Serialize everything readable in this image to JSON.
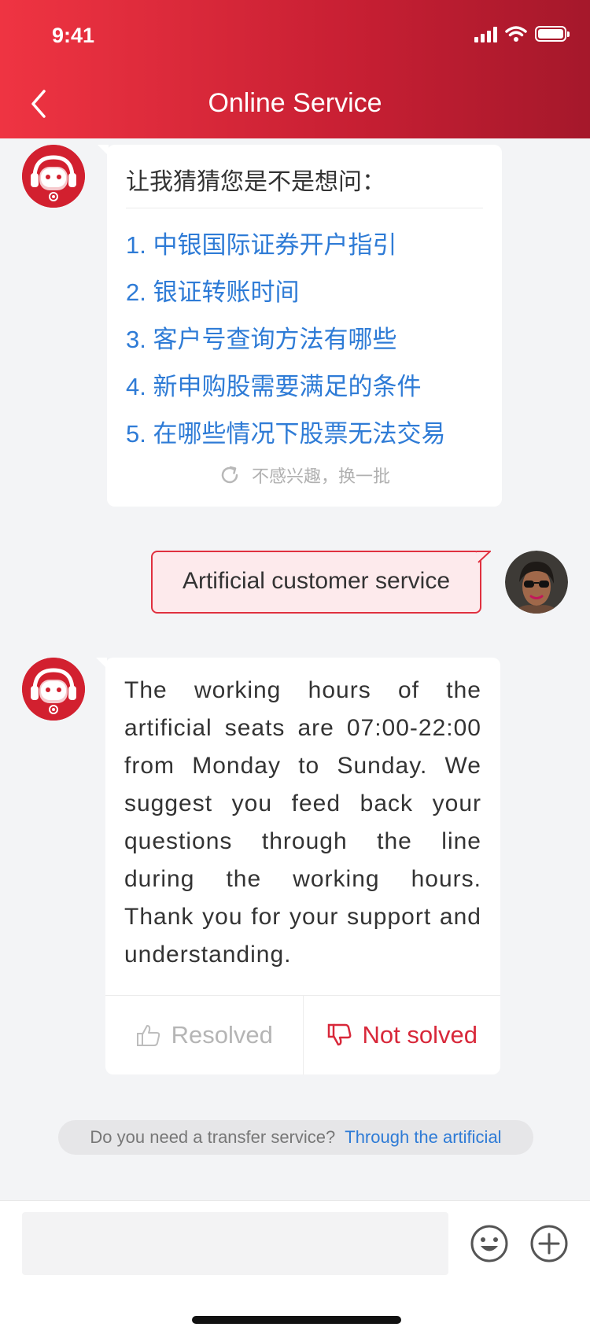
{
  "status_bar": {
    "time": "9:41"
  },
  "header": {
    "title": "Online Service"
  },
  "bot_suggestions": {
    "prompt": "让我猜猜您是不是想问：",
    "questions": [
      "1. 中银国际证券开户指引",
      "2. 银证转账时间",
      "3. 客户号查询方法有哪些",
      "4. 新申购股需要满足的条件",
      "5. 在哪些情况下股票无法交易"
    ],
    "refresh_label": "不感兴趣，换一批"
  },
  "user_message": {
    "text": "Artificial customer service"
  },
  "bot_reply": {
    "text": "The working hours of the artificial seats are 07:00-22:00 from Monday to Sunday. We suggest you feed back your questions through the line during the working hours. Thank you for your support and understanding.",
    "resolved_label": "Resolved",
    "not_solved_label": "Not solved"
  },
  "transfer": {
    "question": "Do you need a transfer service?",
    "link": "Through the artificial"
  },
  "colors": {
    "brand_red": "#d8283a",
    "link_blue": "#2e7bd6"
  }
}
